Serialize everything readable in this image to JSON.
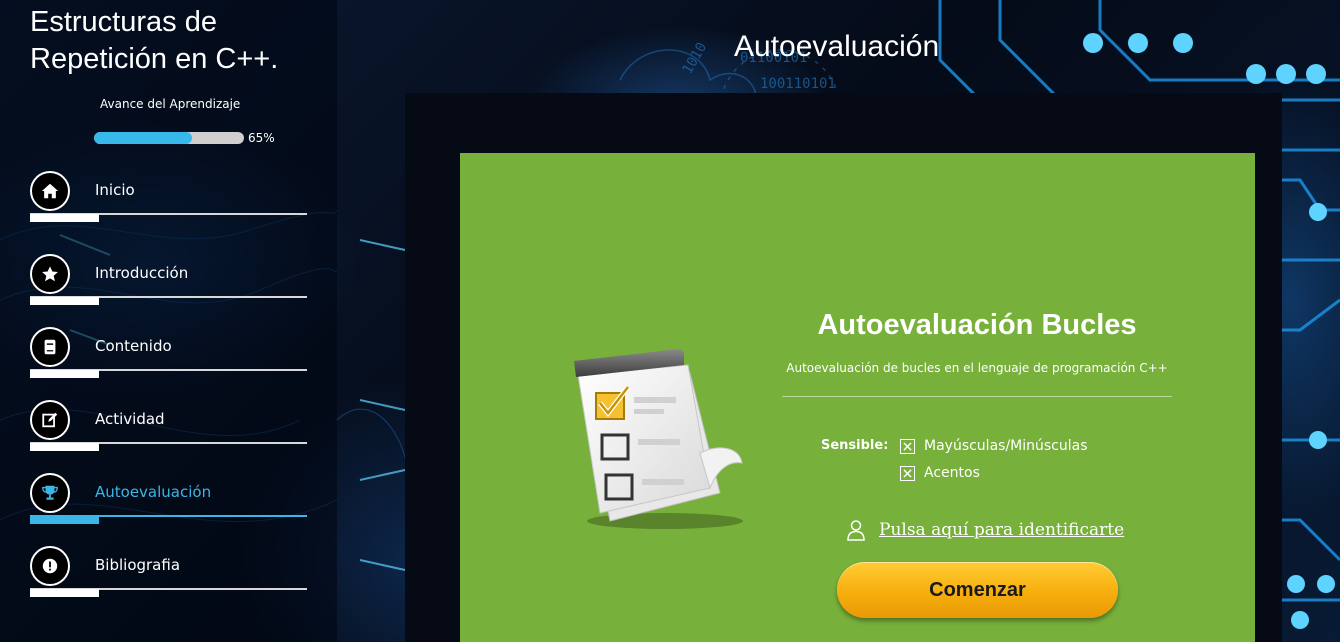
{
  "sidebar": {
    "course_title": "Estructuras de Repetición en C++.",
    "progress": {
      "label": "Avance del Aprendizaje",
      "percent": 65,
      "percent_text": "65%"
    },
    "nav_items": [
      {
        "label": "Inicio",
        "icon": "home-icon",
        "active": false
      },
      {
        "label": "Introducción",
        "icon": "star-icon",
        "active": false
      },
      {
        "label": "Contenido",
        "icon": "book-icon",
        "active": false
      },
      {
        "label": "Actividad",
        "icon": "edit-icon",
        "active": false
      },
      {
        "label": "Autoevaluación",
        "icon": "trophy-icon",
        "active": true
      },
      {
        "label": "Bibliografia",
        "icon": "alert-icon",
        "active": false
      }
    ]
  },
  "main": {
    "page_title": "Autoevaluación"
  },
  "quiz": {
    "title": "Autoevaluación Bucles",
    "description": "Autoevaluación de bucles en el lenguaje de programación C++",
    "sensible_label": "Sensible:",
    "options": [
      {
        "label": "Mayúsculas/Minúsculas",
        "checked": true
      },
      {
        "label": "Acentos",
        "checked": true
      }
    ],
    "identify_link": "Pulsa aquí para identificarte",
    "start_button": "Comenzar",
    "card_color": "#77b03a"
  },
  "colors": {
    "accent": "#3cb6e6",
    "button": "#f7ae0e"
  }
}
